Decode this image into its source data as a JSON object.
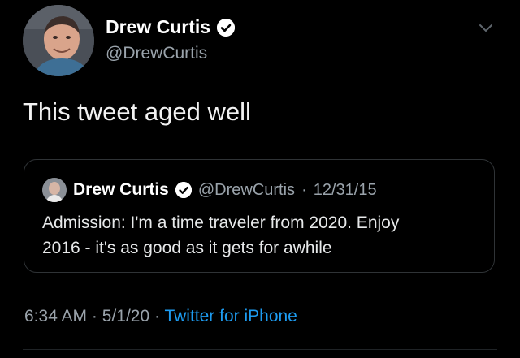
{
  "tweet": {
    "author": {
      "name": "Drew Curtis",
      "handle": "@DrewCurtis",
      "verified": true
    },
    "text": "This tweet aged well",
    "timestamp": "6:34 AM",
    "date": "5/1/20",
    "source": "Twitter for iPhone",
    "separator": "·"
  },
  "quoted_tweet": {
    "author": {
      "name": "Drew Curtis",
      "handle": "@DrewCurtis",
      "verified": true
    },
    "date": "12/31/15",
    "separator": "·",
    "lines": [
      "Admission: I'm a time traveler from 2020. Enjoy",
      "2016 - it's as good as it gets for awhile"
    ]
  },
  "icons": {
    "verified": "verified-badge-icon",
    "menu": "chevron-down-icon"
  },
  "colors": {
    "background": "#000000",
    "text": "#e7e9ea",
    "secondary": "#9aa3ab",
    "accent": "#1d9bf0",
    "border": "#2f3336"
  }
}
